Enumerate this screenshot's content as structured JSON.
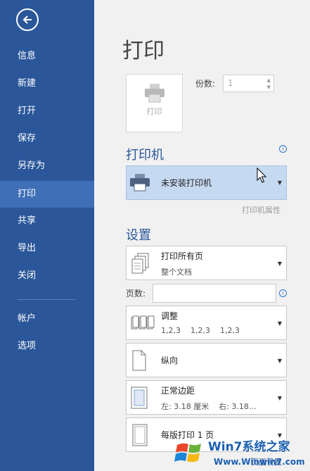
{
  "sidebar": {
    "items": [
      {
        "label": "信息"
      },
      {
        "label": "新建"
      },
      {
        "label": "打开"
      },
      {
        "label": "保存"
      },
      {
        "label": "另存为"
      },
      {
        "label": "打印"
      },
      {
        "label": "共享"
      },
      {
        "label": "导出"
      },
      {
        "label": "关闭"
      },
      {
        "label": "帐户"
      },
      {
        "label": "选项"
      }
    ],
    "active": "打印"
  },
  "main": {
    "title": "打印",
    "print_button_label": "打印",
    "copies_label": "份数:",
    "copies_value": "1",
    "printer_section_title": "打印机",
    "printer_name": "未安装打印机",
    "printer_properties_link": "打印机属性",
    "settings_section_title": "设置",
    "print_range": {
      "title": "打印所有页",
      "subtitle": "整个文档"
    },
    "pages_label": "页数:",
    "pages_value": "",
    "collate": {
      "title": "调整",
      "subtitle": "1,2,3    1,2,3    1,2,3"
    },
    "orientation": "纵向",
    "margins": {
      "title": "正常边距",
      "subtitle": "左: 3.18 厘米    右: 3.18..."
    },
    "pages_per_sheet": "每版打印 1 页",
    "page_setup_link": "页面设置"
  },
  "watermark": {
    "brand": "Win7系统之家",
    "url": "Www.Winwin7.com"
  },
  "colors": {
    "sidebar_bg": "#2b579a",
    "active_item_bg": "#3f6fb6",
    "printer_selected_bg": "#c5d9f1",
    "accent": "#2b579a"
  }
}
